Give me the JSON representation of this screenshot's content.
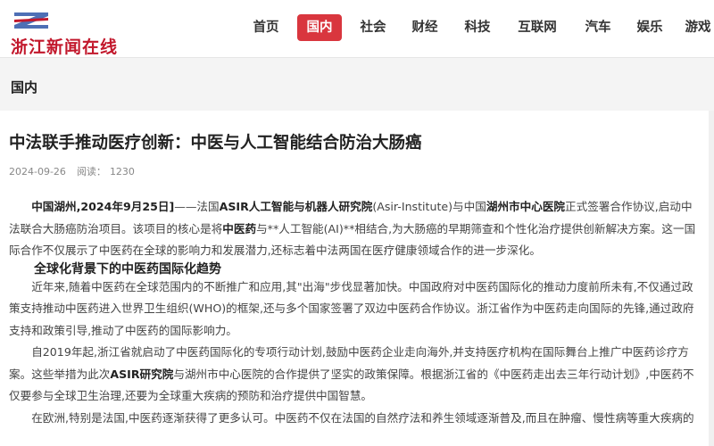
{
  "site": {
    "logo_text": "浙江新闻在线"
  },
  "nav": {
    "items": [
      {
        "label": "首页"
      },
      {
        "label": "国内",
        "active": true
      },
      {
        "label": "社会"
      },
      {
        "label": "财经"
      },
      {
        "label": "科技"
      },
      {
        "label": "互联网"
      },
      {
        "label": "汽车"
      },
      {
        "label": "娱乐"
      },
      {
        "label": "游戏"
      }
    ],
    "active_color": "#d9363e"
  },
  "category": {
    "title": "国内"
  },
  "article": {
    "title": "中法联手推动医疗创新：中医与人工智能结合防治大肠癌",
    "date": "2024-09-26",
    "views_label": "阅读：",
    "views": "1230",
    "lead": {
      "dateline": "中国湖州,2024年9月25日]",
      "t1": "——法国",
      "org1": "ASIR人工智能与机器人研究院",
      "t2": "(Asir-Institute)与中国",
      "org2": "湖州市中心医院",
      "t3": "正式签署合作协议,启动中法联合大肠癌防治项目。该项目的核心是将",
      "tcm": "中医药",
      "t4": "与**人工智能(AI)**相结合,为大肠癌的早期筛查和个性化治疗提供创新解决方案。这一国际合作不仅展示了中医药在全球的影响力和发展潜力,还标志着中法两国在医疗健康领域合作的进一步深化。"
    },
    "section_title": "全球化背景下的中医药国际化趋势",
    "p2": "近年来,随着中医药在全球范围内的不断推广和应用,其\"出海\"步伐显著加快。中国政府对中医药国际化的推动力度前所未有,不仅通过政策支持推动中医药进入世界卫生组织(WHO)的框架,还与多个国家签署了双边中医药合作协议。浙江省作为中医药走向国际的先锋,通过政府支持和政策引导,推动了中医药的国际影响力。",
    "p3": {
      "t1": "自2019年起,浙江省就启动了中医药国际化的专项行动计划,鼓励中医药企业走向海外,并支持医疗机构在国际舞台上推广中医药诊疗方案。这些举措为此次",
      "org": "ASIR研究院",
      "t2": "与湖州市中心医院的合作提供了坚实的政策保障。根据浙江省的《中医药走出去三年行动计划》,中医药不仅要参与全球卫生治理,还要为全球重大疾病的预防和治疗提供中国智慧。"
    },
    "p4": "在欧洲,特别是法国,中医药逐渐获得了更多认可。中医药不仅在法国的自然疗法和养生领域逐渐普及,而且在肿瘤、慢性病等重大疾病的"
  }
}
